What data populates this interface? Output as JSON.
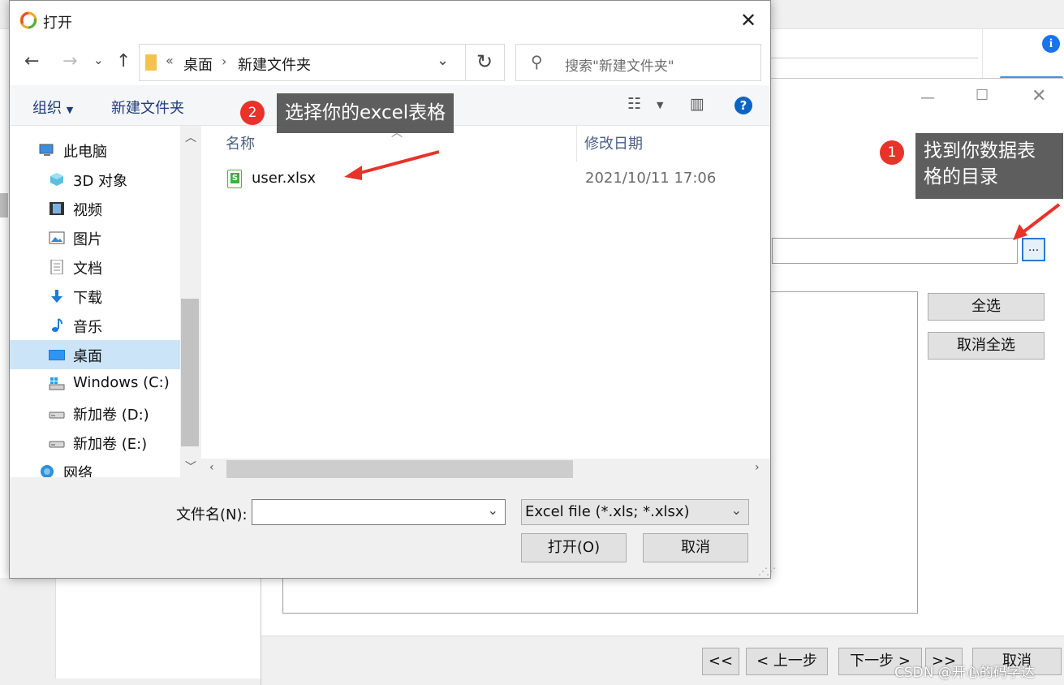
{
  "dialog": {
    "title": "打开",
    "close_label": "✕",
    "address": {
      "chevrons": "«",
      "segments": [
        "桌面",
        "新建文件夹"
      ]
    },
    "search_placeholder": "搜索\"新建文件夹\"",
    "toolbar": {
      "organize": "组织",
      "new_folder": "新建文件夹"
    },
    "nav_items": [
      {
        "label": "此电脑",
        "icon": "computer-icon"
      },
      {
        "label": "3D 对象",
        "icon": "cube-icon"
      },
      {
        "label": "视频",
        "icon": "film-icon"
      },
      {
        "label": "图片",
        "icon": "picture-icon"
      },
      {
        "label": "文档",
        "icon": "document-icon"
      },
      {
        "label": "下载",
        "icon": "download-icon"
      },
      {
        "label": "音乐",
        "icon": "music-icon"
      },
      {
        "label": "桌面",
        "icon": "desktop-icon"
      },
      {
        "label": "Windows  (C:)",
        "icon": "windows-drive-icon"
      },
      {
        "label": "新加卷 (D:)",
        "icon": "drive-icon"
      },
      {
        "label": "新加卷 (E:)",
        "icon": "drive-icon"
      },
      {
        "label": "网络",
        "icon": "network-icon"
      }
    ],
    "columns": {
      "name": "名称",
      "modified": "修改日期"
    },
    "files": [
      {
        "name": "user.xlsx",
        "modified": "2021/10/11 17:06",
        "icon": "excel-file-icon"
      }
    ],
    "filename_label": "文件名(N):",
    "filename_value": "",
    "filter_value": "Excel file (*.xls; *.xlsx)",
    "open_button": "打开(O)",
    "cancel_button": "取消"
  },
  "wizard": {
    "browse_button": "...",
    "select_all": "全选",
    "deselect_all": "取消全选",
    "nav": {
      "first": "<<",
      "prev": "< 上一步",
      "next": "下一步 >",
      "last": ">>",
      "cancel": "取消"
    }
  },
  "annotations": {
    "step1": {
      "number": "1",
      "text_line1": "找到你数据表",
      "text_line2": "格的目录"
    },
    "step2": {
      "number": "2",
      "text": "选择你的excel表格"
    },
    "arrow_color": "#e8322a"
  },
  "watermark": "CSDN @开心的码字达",
  "colors": {
    "selected_row": "#cce4f7",
    "accent_blue": "#0a64c4",
    "badge_red": "#e8322a"
  }
}
